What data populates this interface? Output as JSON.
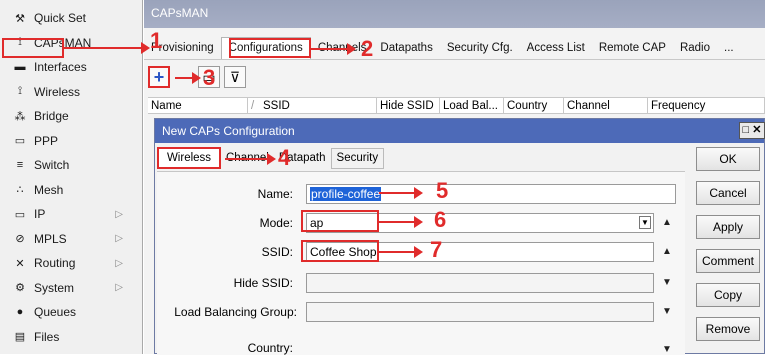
{
  "sidebar": {
    "items": [
      {
        "label": "Quick Set",
        "icon": "quick-set-icon",
        "glyph": "⚒"
      },
      {
        "label": "CAPsMAN",
        "icon": "capsman-icon",
        "glyph": "⟟"
      },
      {
        "label": "Interfaces",
        "icon": "interfaces-icon",
        "glyph": "▬"
      },
      {
        "label": "Wireless",
        "icon": "wireless-icon",
        "glyph": "⟟"
      },
      {
        "label": "Bridge",
        "icon": "bridge-icon",
        "glyph": "⁂"
      },
      {
        "label": "PPP",
        "icon": "ppp-icon",
        "glyph": "▭"
      },
      {
        "label": "Switch",
        "icon": "switch-icon",
        "glyph": "≡"
      },
      {
        "label": "Mesh",
        "icon": "mesh-icon",
        "glyph": "∴"
      },
      {
        "label": "IP",
        "icon": "ip-icon",
        "glyph": "▭",
        "arrow": "▷"
      },
      {
        "label": "MPLS",
        "icon": "mpls-icon",
        "glyph": "⊘",
        "arrow": "▷"
      },
      {
        "label": "Routing",
        "icon": "routing-icon",
        "glyph": "✕",
        "arrow": "▷"
      },
      {
        "label": "System",
        "icon": "system-icon",
        "glyph": "⚙",
        "arrow": "▷"
      },
      {
        "label": "Queues",
        "icon": "queues-icon",
        "glyph": "●"
      },
      {
        "label": "Files",
        "icon": "files-icon",
        "glyph": "▤"
      }
    ]
  },
  "window": {
    "title": "CAPsMAN",
    "tabs": [
      "Provisioning",
      "Configurations",
      "Channels",
      "Datapaths",
      "Security Cfg.",
      "Access List",
      "Remote CAP",
      "Radio",
      "..."
    ],
    "toolbar": {
      "add": "+",
      "copy": "▭",
      "filter": "⊽"
    },
    "columns": [
      "Name",
      "/",
      "SSID",
      "Hide SSID",
      "Load Bal...",
      "Country",
      "Channel",
      "Frequency"
    ]
  },
  "dialog": {
    "title": "New CAPs Configuration",
    "close": "□ ✕",
    "tabs": [
      "Wireless",
      "Channel",
      "Datapath",
      "Security"
    ],
    "fields": {
      "name_label": "Name:",
      "name_value": "profile-coffee",
      "mode_label": "Mode:",
      "mode_value": "ap",
      "ssid_label": "SSID:",
      "ssid_value": "Coffee Shop",
      "hide_label": "Hide SSID:",
      "lb_label": "Load Balancing Group:",
      "country_label": "Country:"
    },
    "buttons": [
      "OK",
      "Cancel",
      "Apply",
      "Comment",
      "Copy",
      "Remove"
    ]
  },
  "annotations": [
    "1",
    "2",
    "3",
    "4",
    "5",
    "6",
    "7"
  ]
}
